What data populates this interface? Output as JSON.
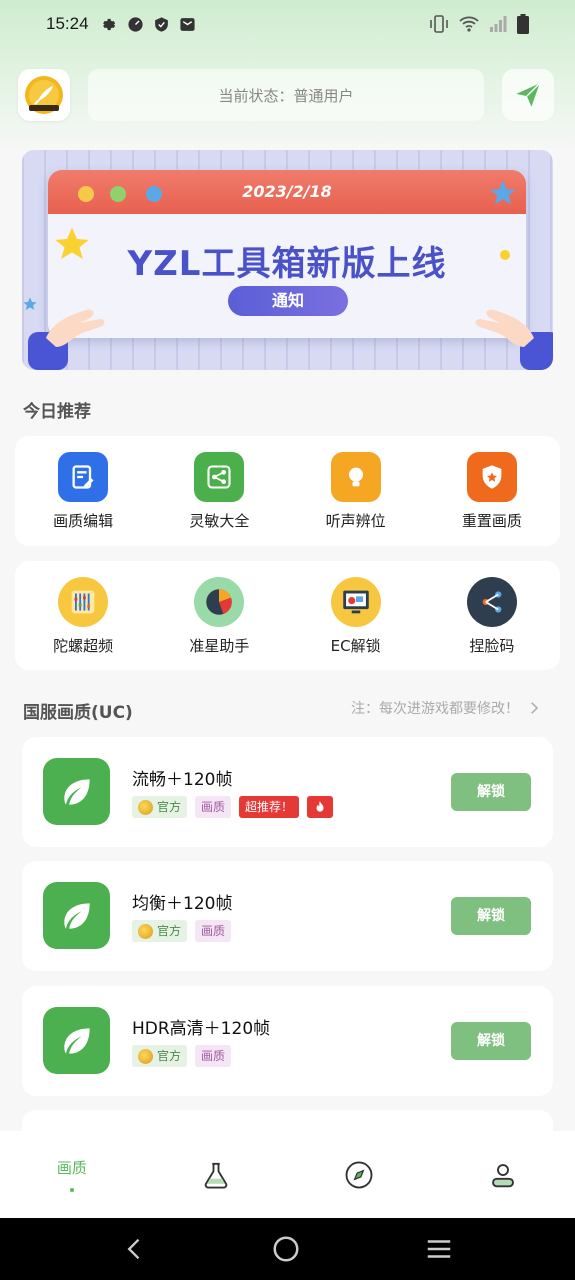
{
  "status_bar": {
    "time": "15:24"
  },
  "header": {
    "status_text": "当前状态：普通用户"
  },
  "banner": {
    "date": "2023/2/18",
    "title": "YZL工具箱新版上线",
    "notice_label": "通知"
  },
  "today": {
    "title": "今日推荐",
    "row1": [
      {
        "label": "画质编辑",
        "icon": "edit-doc-icon",
        "color": "#2f6fe8"
      },
      {
        "label": "灵敏大全",
        "icon": "share-icon",
        "color": "#4bb04b"
      },
      {
        "label": "听声辨位",
        "icon": "bulb-icon",
        "color": "#f5a623"
      },
      {
        "label": "重置画质",
        "icon": "shield-star-icon",
        "color": "#f06a1e"
      }
    ],
    "row2": [
      {
        "label": "陀螺超频",
        "icon": "equalizer-icon",
        "color": "#f8c740"
      },
      {
        "label": "准星助手",
        "icon": "pie-chart-icon",
        "color": "#9ad9a8"
      },
      {
        "label": "EC解锁",
        "icon": "monitor-icon",
        "color": "#f8c740"
      },
      {
        "label": "捏脸码",
        "icon": "network-icon",
        "color": "#2f3e4e"
      }
    ]
  },
  "quality": {
    "title": "国服画质(UC)",
    "note": "注：每次进游戏都要修改！",
    "items": [
      {
        "title": "流畅＋120帧",
        "tag_official": "官方",
        "tag_quality": "画质",
        "tag_hot": "超推荐！",
        "button": "解锁"
      },
      {
        "title": "均衡＋120帧",
        "tag_official": "官方",
        "tag_quality": "画质",
        "button": "解锁"
      },
      {
        "title": "HDR高清＋120帧",
        "tag_official": "官方",
        "tag_quality": "画质",
        "button": "解锁"
      }
    ]
  },
  "bottom_nav": {
    "quality_label": "画质"
  },
  "colors": {
    "accent": "#5cb85c",
    "unlock": "#7fbf7f"
  }
}
